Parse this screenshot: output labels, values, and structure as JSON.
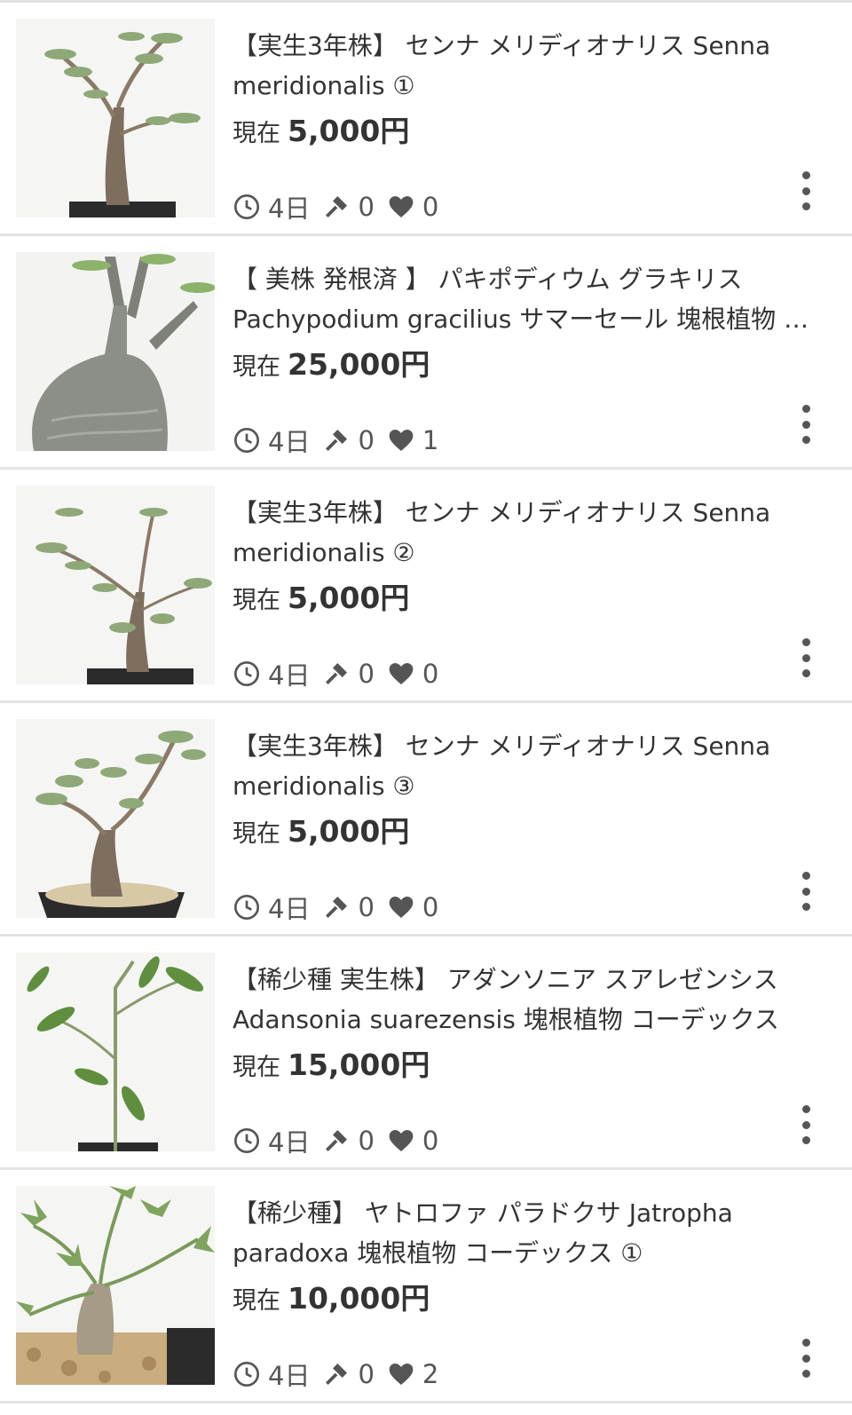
{
  "items": [
    {
      "title": "【実生3年株】 センナ メリディオナリス Senna meridionalis ①",
      "price_prefix": "現在",
      "price": "5,000円",
      "time_left": "4日",
      "bids": "0",
      "likes": "0",
      "image": "senna-plant-1"
    },
    {
      "title": "【 美株 発根済 】 パキポディウム グラキリス Pachypodium gracilius サマーセール 塊根植物 コーデックス",
      "price_prefix": "現在",
      "price": "25,000円",
      "time_left": "4日",
      "bids": "0",
      "likes": "1",
      "image": "pachypodium-plant"
    },
    {
      "title": "【実生3年株】 センナ メリディオナリス Senna meridionalis ②",
      "price_prefix": "現在",
      "price": "5,000円",
      "time_left": "4日",
      "bids": "0",
      "likes": "0",
      "image": "senna-plant-2"
    },
    {
      "title": "【実生3年株】 センナ メリディオナリス Senna meridionalis ③",
      "price_prefix": "現在",
      "price": "5,000円",
      "time_left": "4日",
      "bids": "0",
      "likes": "0",
      "image": "senna-plant-3"
    },
    {
      "title": "【稀少種 実生株】 アダンソニア スアレゼンシス Adansonia suarezensis 塊根植物 コーデックス",
      "price_prefix": "現在",
      "price": "15,000円",
      "time_left": "4日",
      "bids": "0",
      "likes": "0",
      "image": "adansonia-plant"
    },
    {
      "title": "【稀少種】 ヤトロファ パラドクサ Jatropha paradoxa 塊根植物 コーデックス ①",
      "price_prefix": "現在",
      "price": "10,000円",
      "time_left": "4日",
      "bids": "0",
      "likes": "2",
      "image": "jatropha-plant"
    }
  ],
  "icons": {
    "time": "clock-icon",
    "bids": "gavel-icon",
    "likes": "heart-icon",
    "menu": "more-vertical-icon"
  },
  "colors": {
    "separator": "#e3e3e3",
    "icon": "#555555",
    "text": "#333333"
  }
}
